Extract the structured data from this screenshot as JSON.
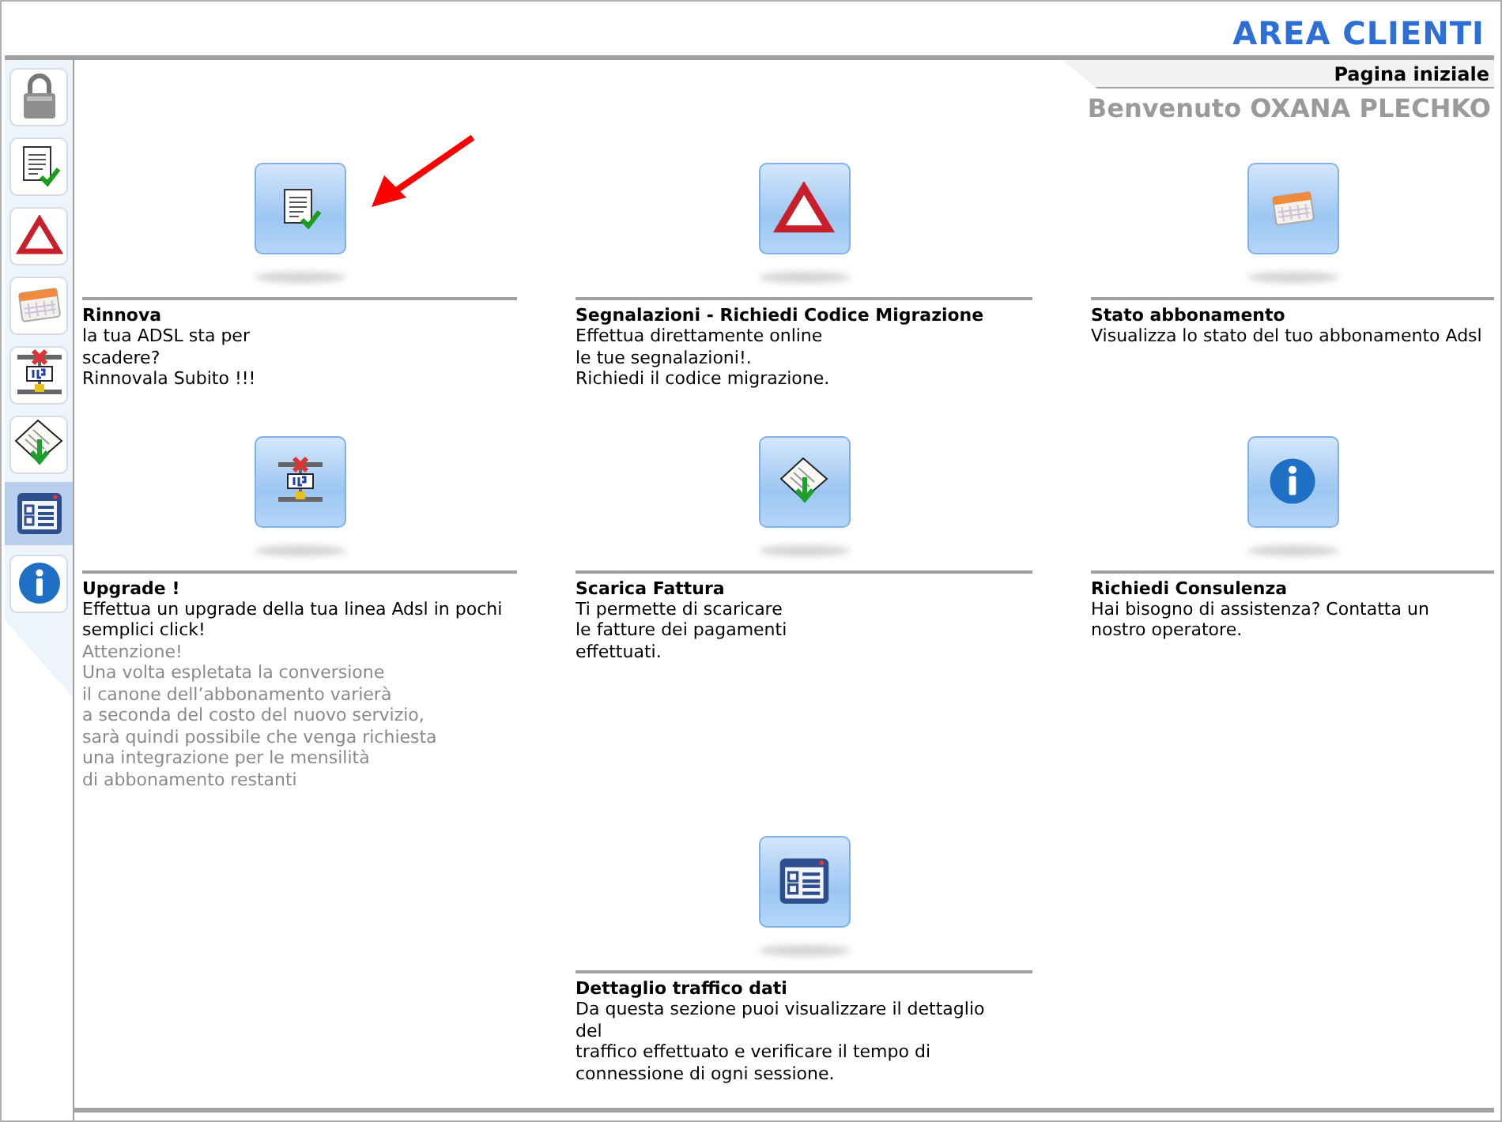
{
  "header": {
    "title": "AREA CLIENTI"
  },
  "tab": {
    "label": "Pagina iniziale"
  },
  "welcome": "Benvenuto OXANA PLECHKO",
  "sidebar": {
    "items": [
      {
        "selected": false
      },
      {
        "selected": false
      },
      {
        "selected": false
      },
      {
        "selected": false
      },
      {
        "selected": false
      },
      {
        "selected": false
      },
      {
        "selected": true
      },
      {
        "selected": false
      }
    ]
  },
  "cards": [
    {
      "title": "Rinnova",
      "description": "la tua ADSL sta per\nscadere?\nRinnovala Subito !!!"
    },
    {
      "title": "Segnalazioni - Richiedi Codice Migrazione",
      "description": "Effettua direttamente online\nle tue segnalazioni!.\nRichiedi il codice migrazione."
    },
    {
      "title": "Stato abbonamento",
      "description": "Visualizza lo stato del tuo abbonamento Adsl"
    },
    {
      "title": "Upgrade !",
      "description": "Effettua un upgrade della tua linea Adsl in pochi\nsemplici click!",
      "note": "Attenzione!\nUna volta espletata la conversione\nil canone dell’abbonamento varierà\na seconda del costo del nuovo servizio,\nsarà quindi possibile che venga richiesta\nuna integrazione per le mensilità\ndi abbonamento restanti"
    },
    {
      "title": "Scarica Fattura",
      "description": "Ti permette di scaricare\nle fatture dei pagamenti\neffettuati."
    },
    {
      "title": "Richiedi Consulenza",
      "description": "Hai bisogno di assistenza? Contatta un\nnostro operatore."
    },
    {
      "title": "Dettaglio traffico dati",
      "description": "Da questa sezione puoi visualizzare il dettaglio\ndel\ntraffico effettuato e verificare il tempo di\nconnessione di ogni sessione."
    }
  ]
}
